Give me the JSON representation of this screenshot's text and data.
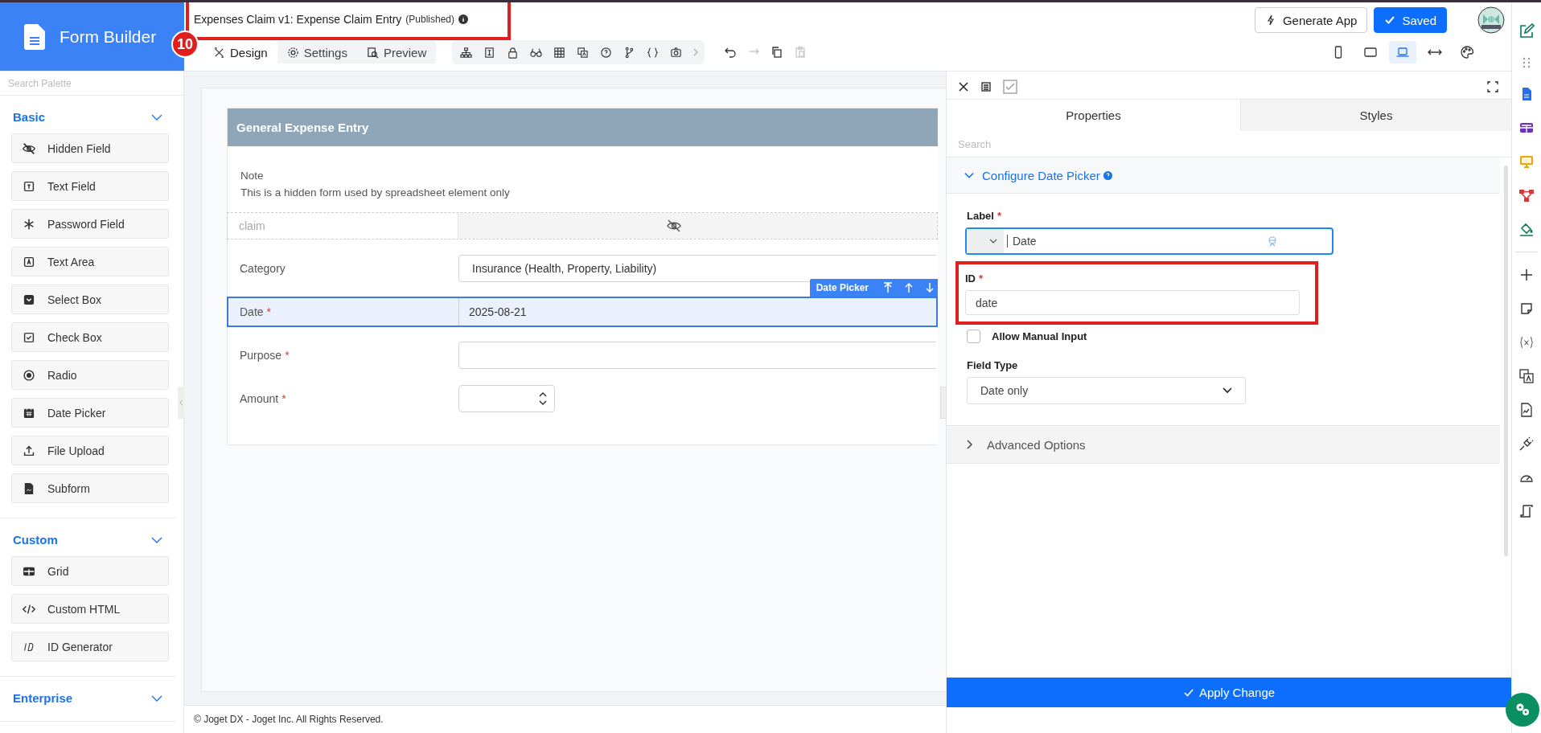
{
  "app": {
    "title": "Form Builder"
  },
  "header": {
    "form_title": "Expenses Claim v1: Expense Claim Entry",
    "status": "(Published)",
    "highlighted": true,
    "step_badge": "10"
  },
  "mode_tabs": [
    {
      "label": "Design",
      "kind": "design",
      "selected": true
    },
    {
      "label": "Settings",
      "kind": "settings",
      "selected": false
    },
    {
      "label": "Preview",
      "kind": "preview",
      "selected": false
    }
  ],
  "edit_actions": [
    {
      "kind": "undo",
      "disabled": false
    },
    {
      "kind": "redo",
      "disabled": true
    },
    {
      "kind": "copy",
      "disabled": false
    },
    {
      "kind": "paste",
      "disabled": true
    }
  ],
  "buttons": [
    {
      "label": "Generate App",
      "kind": "secondary"
    },
    {
      "label": "Saved",
      "kind": "primary"
    }
  ],
  "devices": [
    {
      "kind": "mobile",
      "selected": false
    },
    {
      "kind": "tablet",
      "selected": false
    },
    {
      "kind": "laptop",
      "selected": true
    },
    {
      "kind": "width",
      "selected": false
    },
    {
      "kind": "palette",
      "selected": false
    }
  ],
  "palette": {
    "search_placeholder": "Search Palette",
    "groups": [
      {
        "title": "Basic",
        "expanded": true,
        "items": [
          {
            "label": "Hidden Field",
            "kind": "hidden"
          },
          {
            "label": "Text Field",
            "kind": "text"
          },
          {
            "label": "Password Field",
            "kind": "password"
          },
          {
            "label": "Text Area",
            "kind": "textarea"
          },
          {
            "label": "Select Box",
            "kind": "select"
          },
          {
            "label": "Check Box",
            "kind": "checkbox"
          },
          {
            "label": "Radio",
            "kind": "radio"
          },
          {
            "label": "Date Picker",
            "kind": "date"
          },
          {
            "label": "File Upload",
            "kind": "upload"
          },
          {
            "label": "Subform",
            "kind": "subform"
          }
        ]
      },
      {
        "title": "Custom",
        "expanded": true,
        "items": [
          {
            "label": "Grid",
            "kind": "grid"
          },
          {
            "label": "Custom HTML",
            "kind": "html"
          },
          {
            "label": "ID Generator",
            "kind": "idgen"
          }
        ]
      },
      {
        "title": "Enterprise",
        "expanded": true
      }
    ]
  },
  "form": {
    "section_title": "General Expense Entry",
    "note_title": "Note",
    "note_text": "This is a hidden form used by spreadsheet element only",
    "fields": [
      {
        "kind": "hidden",
        "label": "claim",
        "selected": false
      },
      {
        "kind": "select",
        "label": "Category",
        "value": "Insurance (Health, Property, Liability)",
        "selected": false
      },
      {
        "kind": "date",
        "label": "Date",
        "value": "2025-08-21",
        "required_mark": "*",
        "selected": true
      },
      {
        "kind": "text",
        "label": "Purpose",
        "required_mark": "*",
        "selected": false
      },
      {
        "kind": "number",
        "label": "Amount",
        "required_mark": "*",
        "selected": false
      }
    ]
  },
  "element_toolbar": {
    "label": "Date Picker"
  },
  "properties": {
    "tabs": [
      {
        "label": "Properties",
        "selected": true
      },
      {
        "label": "Styles",
        "selected": false
      }
    ],
    "search_placeholder": "Search",
    "section": {
      "title": "Configure Date Picker",
      "expanded": true
    },
    "label_field": {
      "label": "Label",
      "required_mark": "*",
      "value": "Date"
    },
    "id_field": {
      "label": "ID",
      "required_mark": "*",
      "value": "date",
      "highlighted": true
    },
    "allow_manual": {
      "label": "Allow Manual Input",
      "checked": false
    },
    "field_type": {
      "label": "Field Type",
      "value": "Date only"
    },
    "advanced": {
      "title": "Advanced Options",
      "expanded": false
    },
    "apply_button": "Apply Change"
  },
  "footer": "© Joget DX - Joget Inc. All Rights Reserved."
}
